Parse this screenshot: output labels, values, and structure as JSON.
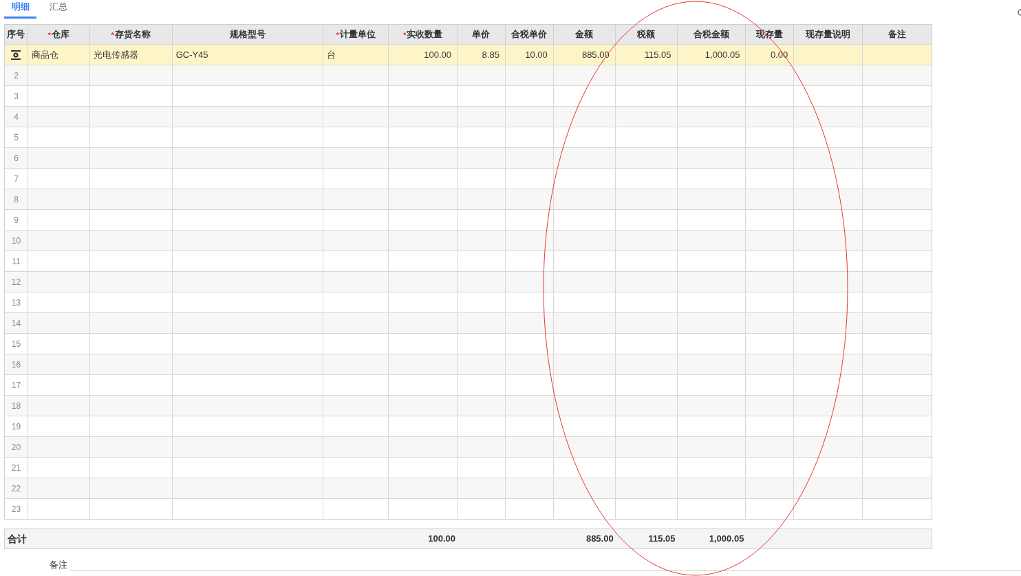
{
  "tabs": [
    {
      "label": "明细",
      "selected": true
    },
    {
      "label": "汇总",
      "selected": false
    }
  ],
  "columns": [
    {
      "label": "序号",
      "kind": "index"
    },
    {
      "label": "仓库",
      "required_mark": "*",
      "kind": "text"
    },
    {
      "label": "存货名称",
      "required_mark": "*",
      "kind": "text"
    },
    {
      "label": "规格型号",
      "kind": "text"
    },
    {
      "label": "计量单位",
      "required_mark": "*",
      "kind": "text"
    },
    {
      "label": "实收数量",
      "required_mark": "*",
      "kind": "number"
    },
    {
      "label": "单价",
      "kind": "number"
    },
    {
      "label": "合税单价",
      "kind": "number"
    },
    {
      "label": "金额",
      "kind": "number"
    },
    {
      "label": "税额",
      "kind": "number"
    },
    {
      "label": "合税金额",
      "kind": "number"
    },
    {
      "label": "现存量",
      "kind": "number"
    },
    {
      "label": "现存量说明",
      "kind": "text"
    },
    {
      "label": "备注",
      "kind": "text"
    }
  ],
  "rows": [
    {
      "selected": true,
      "cells": [
        null,
        "商品仓",
        "光电传感器",
        "GC-Y45",
        "台",
        "100.00",
        "8.85",
        "10.00",
        "885.00",
        "115.05",
        "1,000.05",
        "0.00",
        null,
        null
      ]
    },
    {
      "selected": false,
      "index": "2"
    },
    {
      "selected": false,
      "index": "3"
    },
    {
      "selected": false,
      "index": "4"
    },
    {
      "selected": false,
      "index": "5"
    },
    {
      "selected": false,
      "index": "6"
    },
    {
      "selected": false,
      "index": "7"
    },
    {
      "selected": false,
      "index": "8"
    },
    {
      "selected": false,
      "index": "9"
    },
    {
      "selected": false,
      "index": "10"
    },
    {
      "selected": false,
      "index": "11"
    },
    {
      "selected": false,
      "index": "12"
    },
    {
      "selected": false,
      "index": "13"
    },
    {
      "selected": false,
      "index": "14"
    },
    {
      "selected": false,
      "index": "15"
    },
    {
      "selected": false,
      "index": "16"
    },
    {
      "selected": false,
      "index": "17"
    },
    {
      "selected": false,
      "index": "18"
    },
    {
      "selected": false,
      "index": "19"
    },
    {
      "selected": false,
      "index": "20"
    },
    {
      "selected": false,
      "index": "21"
    },
    {
      "selected": false,
      "index": "22"
    },
    {
      "selected": false,
      "index": "23"
    }
  ],
  "totals": {
    "label": "合计",
    "cells": [
      null,
      null,
      null,
      null,
      null,
      "100.00",
      null,
      null,
      "885.00",
      "115.05",
      "1,000.05",
      null,
      null,
      null
    ]
  },
  "remark": {
    "label": "备注"
  }
}
